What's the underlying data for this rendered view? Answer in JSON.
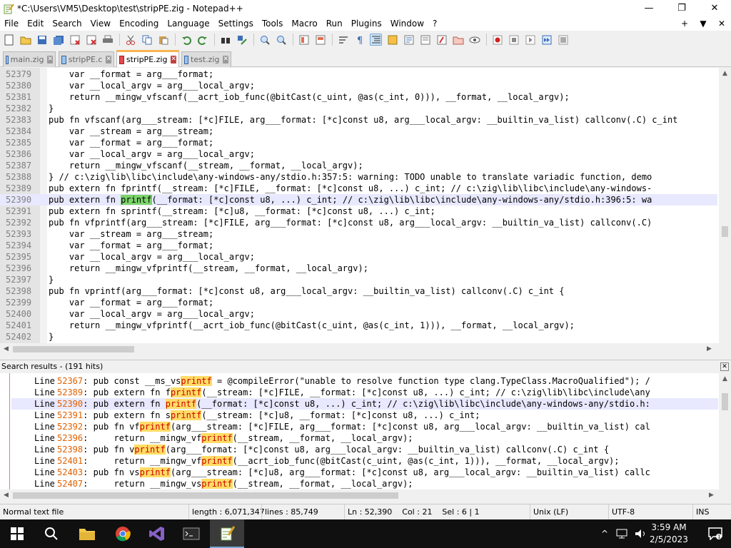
{
  "window": {
    "title": "*C:\\Users\\VM5\\Desktop\\test\\stripPE.zig - Notepad++",
    "minimize_glyph": "—",
    "maximize_glyph": "❐",
    "close_glyph": "✕"
  },
  "menu": {
    "items": [
      "File",
      "Edit",
      "Search",
      "View",
      "Encoding",
      "Language",
      "Settings",
      "Tools",
      "Macro",
      "Run",
      "Plugins",
      "Window",
      "?"
    ],
    "right": [
      "+",
      "▼",
      "✕"
    ]
  },
  "tabs": [
    {
      "label": "main.zig",
      "active": false
    },
    {
      "label": "stripPE.c",
      "active": false
    },
    {
      "label": "stripPE.zig",
      "active": true
    },
    {
      "label": "test.zig",
      "active": false
    }
  ],
  "tab_close_glyph": "✕",
  "editor": {
    "lines": [
      {
        "num": "52379",
        "text": "    var __format = arg___format;"
      },
      {
        "num": "52380",
        "text": "    var __local_argv = arg___local_argv;"
      },
      {
        "num": "52381",
        "text": "    return __mingw_vfscanf(__acrt_iob_func(@bitCast(c_uint, @as(c_int, 0))), __format, __local_argv);"
      },
      {
        "num": "52382",
        "text": "}"
      },
      {
        "num": "52383",
        "text": "pub fn vfscanf(arg___stream: [*c]FILE, arg___format: [*c]const u8, arg___local_argv: __builtin_va_list) callconv(.C) c_int"
      },
      {
        "num": "52384",
        "text": "    var __stream = arg___stream;"
      },
      {
        "num": "52385",
        "text": "    var __format = arg___format;"
      },
      {
        "num": "52386",
        "text": "    var __local_argv = arg___local_argv;"
      },
      {
        "num": "52387",
        "text": "    return __mingw_vfscanf(__stream, __format, __local_argv);"
      },
      {
        "num": "52388",
        "text": "} // c:\\zig\\lib\\libc\\include\\any-windows-any/stdio.h:357:5: warning: TODO unable to translate variadic function, demo"
      },
      {
        "num": "52389",
        "text": "pub extern fn fprintf(__stream: [*c]FILE, __format: [*c]const u8, ...) c_int; // c:\\zig\\lib\\libc\\include\\any-windows-"
      },
      {
        "num": "52390",
        "text_before": "pub extern fn ",
        "text_match": "printf",
        "text_after": "(__format: [*c]const u8, ...) c_int; // c:\\zig\\lib\\libc\\include\\any-windows-any/stdio.h:396:5: wa"
      },
      {
        "num": "52391",
        "text": "pub extern fn sprintf(__stream: [*c]u8, __format: [*c]const u8, ...) c_int;"
      },
      {
        "num": "52392",
        "text": "pub fn vfprintf(arg___stream: [*c]FILE, arg___format: [*c]const u8, arg___local_argv: __builtin_va_list) callconv(.C)"
      },
      {
        "num": "52393",
        "text": "    var __stream = arg___stream;"
      },
      {
        "num": "52394",
        "text": "    var __format = arg___format;"
      },
      {
        "num": "52395",
        "text": "    var __local_argv = arg___local_argv;"
      },
      {
        "num": "52396",
        "text": "    return __mingw_vfprintf(__stream, __format, __local_argv);"
      },
      {
        "num": "52397",
        "text": "}"
      },
      {
        "num": "52398",
        "text": "pub fn vprintf(arg___format: [*c]const u8, arg___local_argv: __builtin_va_list) callconv(.C) c_int {"
      },
      {
        "num": "52399",
        "text": "    var __format = arg___format;"
      },
      {
        "num": "52400",
        "text": "    var __local_argv = arg___local_argv;"
      },
      {
        "num": "52401",
        "text": "    return __mingw_vfprintf(__acrt_iob_func(@bitCast(c_uint, @as(c_int, 1))), __format, __local_argv);"
      },
      {
        "num": "52402",
        "text": "}"
      }
    ]
  },
  "search_results": {
    "header": "Search results - (191 hits)",
    "close_glyph": "✕",
    "line_label": "Line",
    "rows": [
      {
        "num": "52367",
        "pre": ": pub const __ms_vs",
        "match": "printf",
        "post": " = @compileError(\"unable to resolve function type clang.TypeClass.MacroQualified\"); /"
      },
      {
        "num": "52389",
        "pre": ": pub extern fn f",
        "match": "printf",
        "post": "(__stream: [*c]FILE, __format: [*c]const u8, ...) c_int; // c:\\zig\\lib\\libc\\include\\any"
      },
      {
        "num": "52390",
        "pre": ": pub extern fn ",
        "match": "printf",
        "post": "(__format: [*c]const u8, ...) c_int; // c:\\zig\\lib\\libc\\include\\any-windows-any/stdio.h:"
      },
      {
        "num": "52391",
        "pre": ": pub extern fn s",
        "match": "printf",
        "post": "(__stream: [*c]u8, __format: [*c]const u8, ...) c_int;"
      },
      {
        "num": "52392",
        "pre": ": pub fn vf",
        "match": "printf",
        "post": "(arg___stream: [*c]FILE, arg___format: [*c]const u8, arg___local_argv: __builtin_va_list) cal"
      },
      {
        "num": "52396",
        "pre": ":     return __mingw_vf",
        "match": "printf",
        "post": "(__stream, __format, __local_argv);"
      },
      {
        "num": "52398",
        "pre": ": pub fn v",
        "match": "printf",
        "post": "(arg___format: [*c]const u8, arg___local_argv: __builtin_va_list) callconv(.C) c_int {"
      },
      {
        "num": "52401",
        "pre": ":     return __mingw_vf",
        "match": "printf",
        "post": "(__acrt_iob_func(@bitCast(c_uint, @as(c_int, 1))), __format, __local_argv);"
      },
      {
        "num": "52403",
        "pre": ": pub fn vs",
        "match": "printf",
        "post": "(arg___stream: [*c]u8, arg___format: [*c]const u8, arg___local_argv: __builtin_va_list) callc"
      },
      {
        "num": "52407",
        "pre": ":     return __mingw_vs",
        "match": "printf",
        "post": "(__stream, __format, __local_argv);"
      }
    ]
  },
  "status": {
    "file_type": "Normal text file",
    "length": "length : 6,071,347",
    "lines": "lines : 85,749",
    "position": "Ln : 52,390    Col : 21    Sel : 6 | 1",
    "eol": "Unix (LF)",
    "encoding": "UTF-8",
    "mode": "INS"
  },
  "taskbar": {
    "time": "3:59 AM",
    "date": "2/5/2023",
    "tray_caret": "^"
  },
  "colors": {
    "accent_tab": "#fab450",
    "match_highlight": "#7bd36a",
    "search_match": "#ffdc64",
    "current_line": "#e8e8ff"
  }
}
